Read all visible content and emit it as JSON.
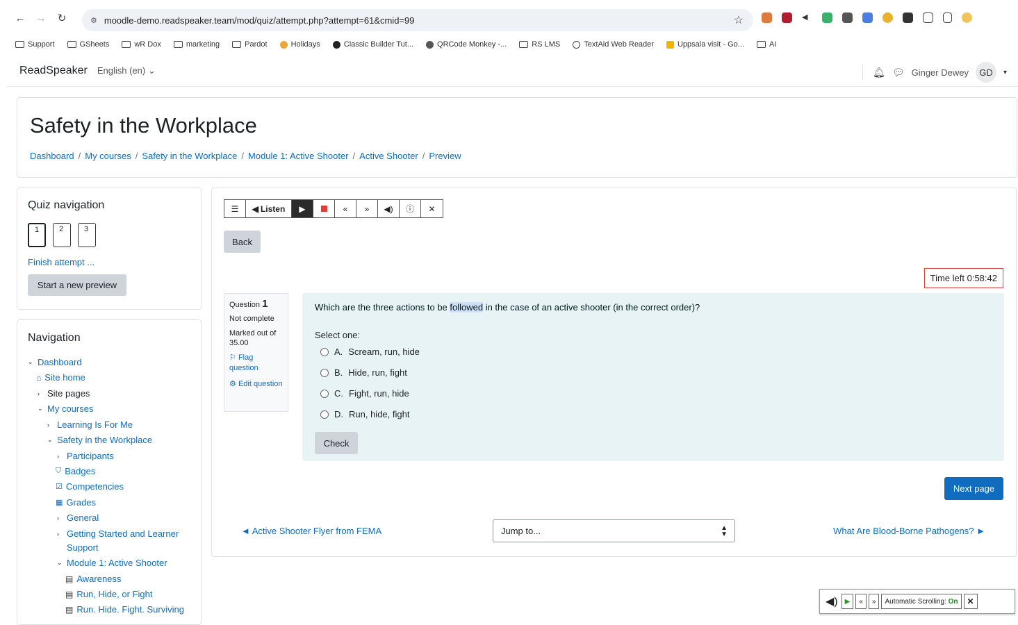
{
  "browser": {
    "url": "moodle-demo.readspeaker.team/mod/quiz/attempt.php?attempt=61&cmid=99",
    "bookmarks": [
      "Support",
      "GSheets",
      "wR Dox",
      "marketing",
      "Pardot",
      "Holidays",
      "Classic Builder Tut...",
      "QRCode Monkey -...",
      "RS LMS",
      "TextAid Web Reader",
      "Uppsala visit - Go...",
      "AI"
    ]
  },
  "header": {
    "brand": "ReadSpeaker",
    "language": "English (en) ⌄",
    "user_name": "Ginger Dewey",
    "user_initials": "GD"
  },
  "page": {
    "title": "Safety in the Workplace",
    "breadcrumb": [
      "Dashboard",
      "My courses",
      "Safety in the Workplace",
      "Module 1: Active Shooter",
      "Active Shooter",
      "Preview"
    ]
  },
  "quiz_nav": {
    "title": "Quiz navigation",
    "questions": [
      "1",
      "2",
      "3"
    ],
    "finish_label": "Finish attempt ...",
    "new_preview_label": "Start a new preview"
  },
  "navigation": {
    "title": "Navigation",
    "items": [
      "Dashboard",
      "Site home",
      "Site pages",
      "My courses",
      "Learning Is For Me",
      "Safety in the Workplace",
      "Participants",
      "Badges",
      "Competencies",
      "Grades",
      "General",
      "Getting Started and Learner",
      "Support",
      "Module 1: Active Shooter",
      "Awareness",
      "Run, Hide, or Fight",
      "Run. Hide. Fight. Surviving"
    ]
  },
  "readspeaker": {
    "listen_label": "Listen",
    "auto_scroll_label": "Automatic Scrolling:",
    "auto_scroll_state": "On"
  },
  "quiz": {
    "back_label": "Back",
    "timer": "Time left 0:58:42",
    "question_label": "Question",
    "question_number": "1",
    "status": "Not complete",
    "marked_out_of": "Marked out of",
    "marks": "35.00",
    "flag_label": "Flag question",
    "edit_label": "Edit question",
    "question_text_before": "Which are the three actions to be ",
    "question_text_highlight": "followed",
    "question_text_after": " in the case of an active shooter (in the correct order)?",
    "select_one": "Select one:",
    "options": [
      {
        "letter": "A.",
        "text": "Scream, run, hide"
      },
      {
        "letter": "B.",
        "text": "Hide, run, fight"
      },
      {
        "letter": "C.",
        "text": "Fight, run, hide"
      },
      {
        "letter": "D.",
        "text": "Run, hide, fight"
      }
    ],
    "check_label": "Check",
    "next_page_label": "Next page",
    "prev_activity": "◄ Active Shooter Flyer from FEMA",
    "jump_to": "Jump to...",
    "next_activity": "What Are Blood-Borne Pathogens? ►"
  }
}
